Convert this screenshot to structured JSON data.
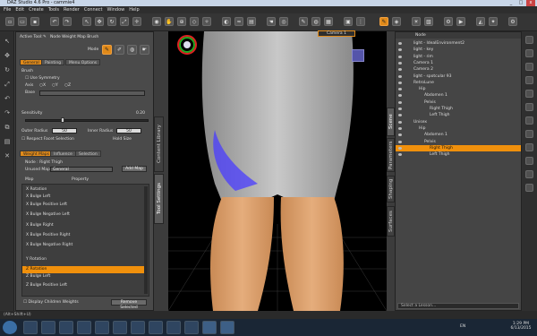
{
  "window": {
    "title": "DAZ Studio 4.6 Pro - cammie4"
  },
  "menu": [
    "File",
    "Edit",
    "Create",
    "Tools",
    "Render",
    "Connect",
    "Window",
    "Help"
  ],
  "toolbar": {
    "icons": [
      "new",
      "open",
      "save",
      "undo",
      "redo",
      "select",
      "translate",
      "rotate",
      "scale",
      "universal",
      "camera",
      "pose",
      "joint",
      "node-weight-map-brush",
      "surface",
      "render",
      "render-settings",
      "spot-render"
    ],
    "active_index": 13
  },
  "left_panel": {
    "active_tool_label": "Active Tool:",
    "active_tool_name": "Node Weight Map Brush",
    "mode_label": "Mode",
    "tabs": [
      "General",
      "Painting",
      "Menu Options"
    ],
    "brush_section": "Brush",
    "use_symmetry": "Use Symmetry",
    "axis_label": "Axis",
    "axis_values": [
      "X",
      "Y",
      "Z"
    ],
    "base_label": "Base",
    "sensitivity_label": "Sensitivity",
    "sensitivity_value": "0.20",
    "outer_radius_label": "Outer Radius",
    "outer_radius_value": "50",
    "inner_radius_label": "Inner Radius",
    "inner_radius_value": "50",
    "respect_facet": "Respect Facet Selection",
    "hold_size_label": "Hold Size",
    "lower_tabs": [
      "Weight Maps",
      "Influence",
      "Selection"
    ],
    "node_label": "Node : Right Thigh",
    "unused_maps_label": "Unused Maps",
    "unused_maps_value": "General",
    "add_map_button": "Add Map",
    "map_header": "Map",
    "property_header": "Property",
    "map_items": [
      "X Rotation",
      "X Bulge Left",
      "X Bulge Positive Left",
      "X Bulge Negative Left",
      "X Bulge Right",
      "X Bulge Positive Right",
      "X Bulge Negative Right",
      "",
      "Y Rotation",
      "Z Rotation",
      "Z Bulge Left",
      "Z Bulge Positive Left"
    ],
    "selected_map_index": 9,
    "display_children": "Display Children Weights",
    "remove_button": "Remove Selected",
    "side_tabs": [
      "Content Library",
      "Tool Settings"
    ]
  },
  "viewport": {
    "camera_label": "Camera 1"
  },
  "right_panel": {
    "header": "Node",
    "items": [
      {
        "label": "light - IdealEnvironment2",
        "indent": 0
      },
      {
        "label": "light - key",
        "indent": 0
      },
      {
        "label": "light - rim",
        "indent": 0
      },
      {
        "label": "Camera 1",
        "indent": 0
      },
      {
        "label": "Camera 2",
        "indent": 0
      },
      {
        "label": "light - spotcular 93",
        "indent": 0
      },
      {
        "label": "RetroLune",
        "indent": 0
      },
      {
        "label": "Hip",
        "indent": 1
      },
      {
        "label": "Abdomen 1",
        "indent": 2
      },
      {
        "label": "Pelvis",
        "indent": 2
      },
      {
        "label": "Right Thigh",
        "indent": 3
      },
      {
        "label": "Left Thigh",
        "indent": 3
      },
      {
        "label": "Unisex",
        "indent": 0
      },
      {
        "label": "Hip",
        "indent": 1
      },
      {
        "label": "Abdomen 1",
        "indent": 2
      },
      {
        "label": "Pelvis",
        "indent": 2
      },
      {
        "label": "Right Thigh",
        "indent": 3
      },
      {
        "label": "Left Thigh",
        "indent": 3
      }
    ],
    "selected_index": 16,
    "side_tabs": [
      "Scene",
      "Parameters",
      "Shaping",
      "Surfaces"
    ],
    "lesson_placeholder": "Select a Lesson..."
  },
  "statusbar": {
    "text": "(Alt+Shift+U)"
  },
  "taskbar": {
    "time": "1:29 PM",
    "date": "6/13/2015",
    "lang": "EN"
  }
}
